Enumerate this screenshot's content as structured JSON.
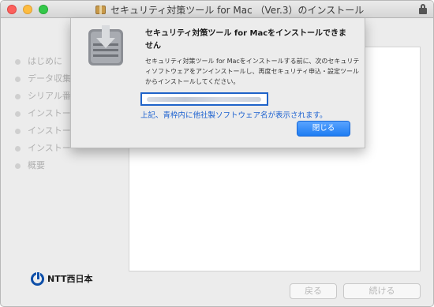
{
  "window": {
    "title": "セキュリティ対策ツール for Mac （Ver.3）のインストール"
  },
  "sidebar": {
    "steps": [
      {
        "label": "はじめに"
      },
      {
        "label": "データ収集"
      },
      {
        "label": "シリアル番"
      },
      {
        "label": "インストー"
      },
      {
        "label": "インストー"
      },
      {
        "label": "インストー"
      },
      {
        "label": "概要"
      }
    ]
  },
  "footer": {
    "logo_text": "NTT西日本",
    "back_label": "戻る",
    "continue_label": "続ける"
  },
  "dialog": {
    "title": "セキュリティ対策ツール for Macをインストールできません",
    "body": "セキュリティ対策ツール for Macをインストールする前に、次のセキュリティソフトウェアをアンインストールし、再度セキュリティ申込・設定ツールからインストールしてください。",
    "annotation": "上記、青枠内に他社製ソフトウェア名が表示されます。",
    "close_label": "閉じる"
  },
  "colors": {
    "accent_blue": "#1d7cf2",
    "annotation_blue": "#1a60d0",
    "ntt_blue": "#0d4ea8"
  }
}
